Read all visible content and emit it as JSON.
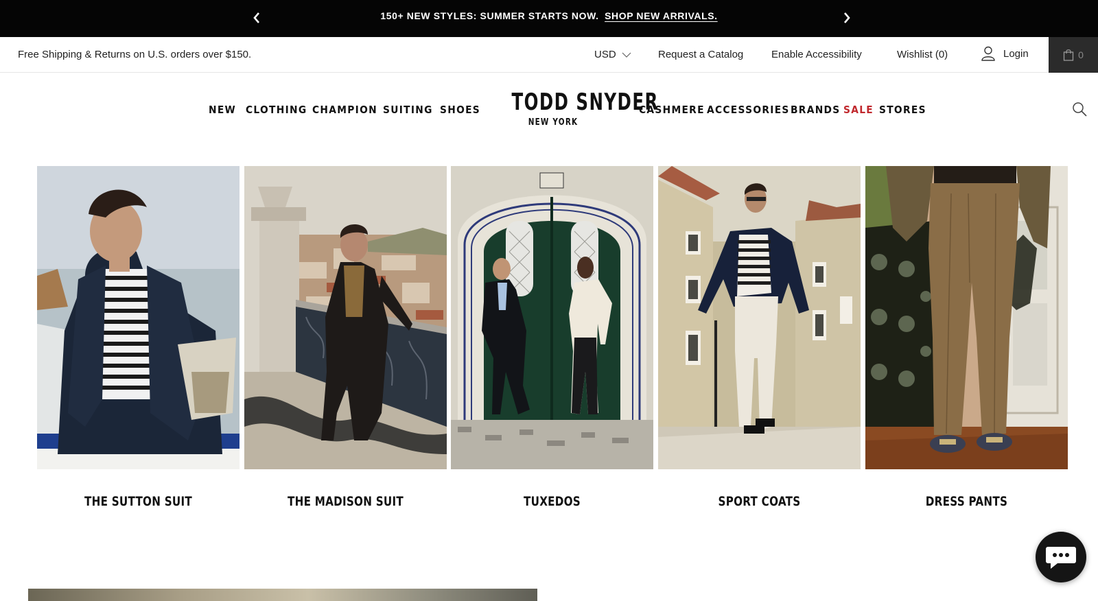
{
  "announcement": {
    "message": "150+ NEW STYLES: SUMMER STARTS NOW.",
    "link": "SHOP NEW ARRIVALS."
  },
  "utility": {
    "shipping": "Free Shipping & Returns on U.S. orders over $150.",
    "currency": "USD",
    "catalog": "Request a Catalog",
    "accessibility": "Enable Accessibility",
    "wishlist": "Wishlist (0)",
    "login": "Login",
    "cart_count": "0"
  },
  "nav": {
    "left": [
      "NEW",
      "CLOTHING",
      "CHAMPION",
      "SUITING",
      "SHOES"
    ],
    "right": [
      "CASHMERE",
      "ACCESSORIES",
      "BRANDS",
      "SALE",
      "STORES"
    ]
  },
  "logo": {
    "brand": "TODD SNYDER",
    "city": "NEW YORK"
  },
  "tiles": [
    {
      "label": "THE SUTTON SUIT"
    },
    {
      "label": "THE MADISON SUIT"
    },
    {
      "label": "TUXEDOS"
    },
    {
      "label": "SPORT COATS"
    },
    {
      "label": "DRESS PANTS"
    }
  ],
  "colors": {
    "announce_bg": "#050505",
    "sale": "#c0282d",
    "cart_bg": "#2b2b2b"
  }
}
